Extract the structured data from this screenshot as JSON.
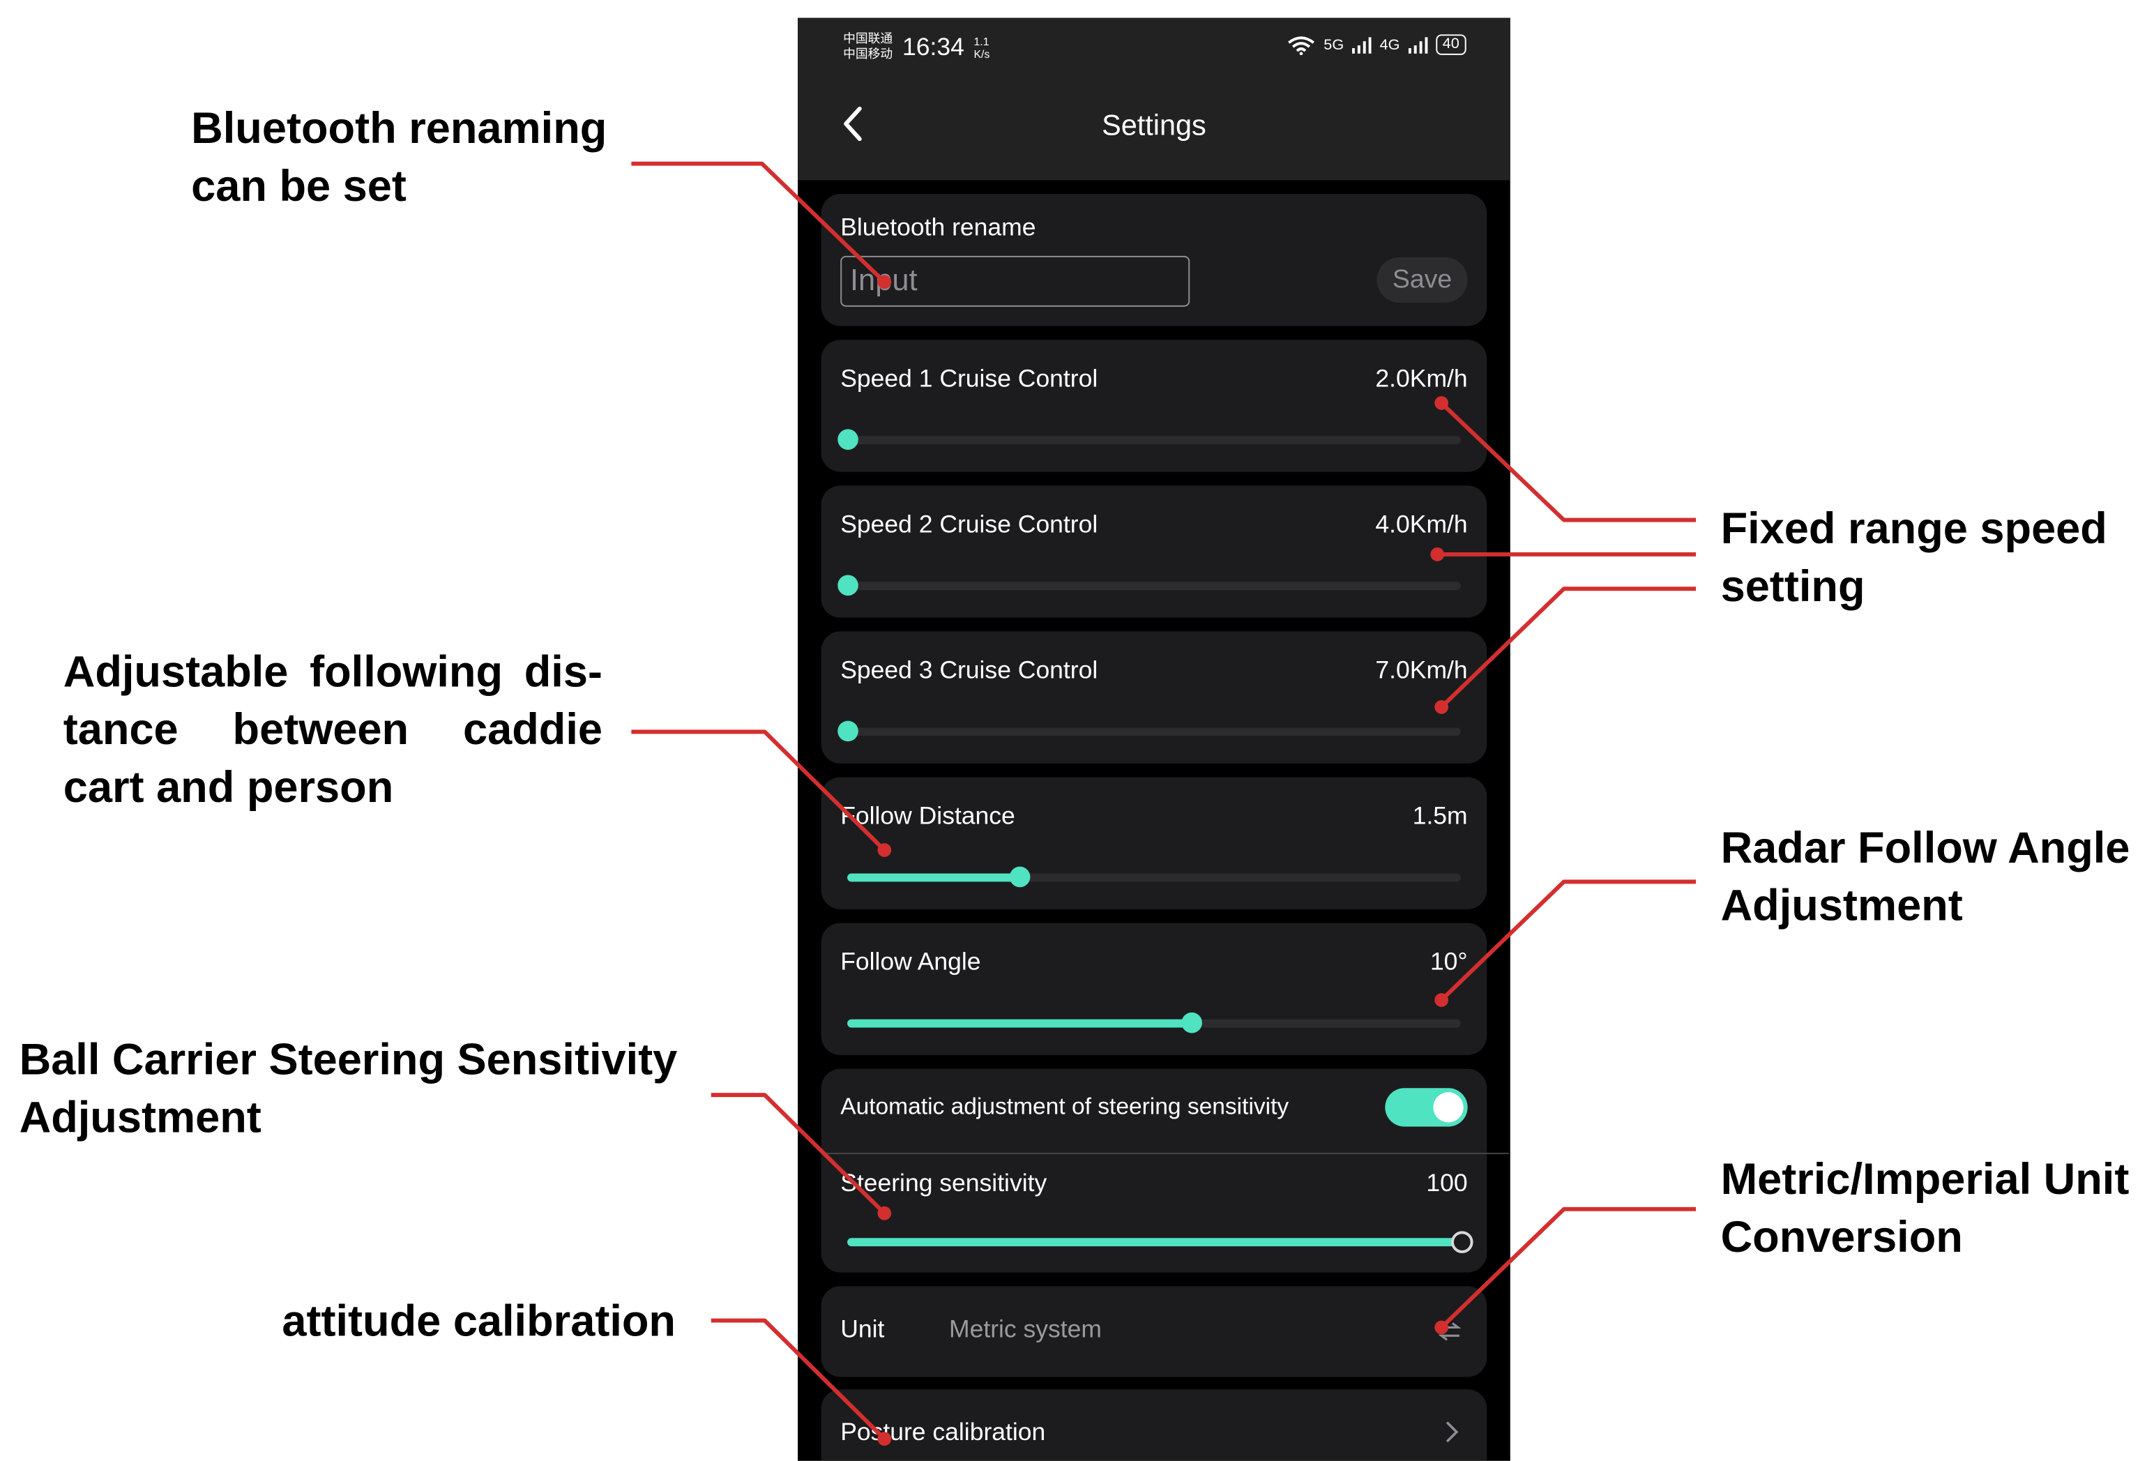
{
  "annotations": {
    "bluetooth": "Bluetooth renaming can be set",
    "speed": "Fixed range speed setting",
    "distance": "Adjustable following dis- tance between caddie cart and person",
    "angle": "Radar Follow Angle Adjustment",
    "steering": "Ball Carrier Steering Sensitivity Adjustment",
    "unit": "Metric/Imperial Unit Conversion",
    "attitude": "attitude calibration"
  },
  "status_bar": {
    "carrier_1": "中国联通",
    "carrier_2": "中国移动",
    "time": "16:34",
    "net_speed_value": "1.1",
    "net_speed_unit": "K/s",
    "signal_1": "5G",
    "signal_2": "4G",
    "battery": "40"
  },
  "header": {
    "title": "Settings"
  },
  "bluetooth": {
    "label": "Bluetooth rename",
    "placeholder": "Input",
    "save_label": "Save"
  },
  "sliders": [
    {
      "label": "Speed 1 Cruise Control",
      "value": "2.0Km/h",
      "fraction": 0.0
    },
    {
      "label": "Speed 2 Cruise Control",
      "value": "4.0Km/h",
      "fraction": 0.0
    },
    {
      "label": "Speed 3 Cruise Control",
      "value": "7.0Km/h",
      "fraction": 0.0
    },
    {
      "label": "Follow Distance",
      "value": "1.5m",
      "fraction": 0.28
    },
    {
      "label": "Follow Angle",
      "value": "10°",
      "fraction": 0.56
    }
  ],
  "steering": {
    "auto_label": "Automatic adjustment of steering sensitivity",
    "auto_enabled": true,
    "label": "Steering sensitivity",
    "value": "100",
    "fraction": 1.0
  },
  "unit": {
    "label": "Unit",
    "value": "Metric system"
  },
  "posture": {
    "label": "Posture calibration"
  },
  "colors": {
    "accent": "#4fe3c1",
    "annotation_line": "#d32f2f",
    "card": "#1c1c1e",
    "topbar": "#222223"
  },
  "icons": {
    "back": "chevron-left-icon",
    "unit": "swap-icon",
    "posture": "chevron-right-icon"
  }
}
